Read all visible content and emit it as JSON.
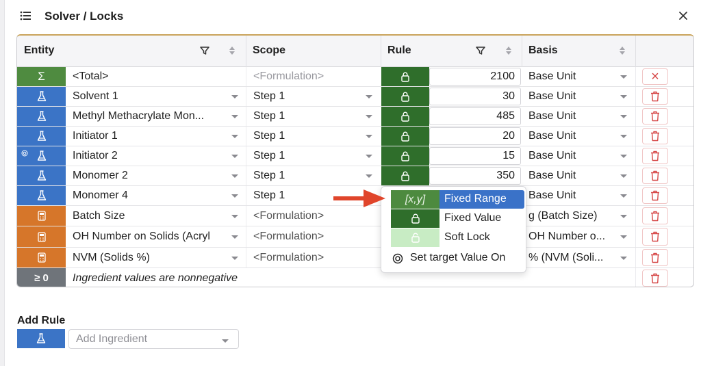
{
  "header": {
    "title": "Solver / Locks"
  },
  "table": {
    "columns": {
      "entity": "Entity",
      "scope": "Scope",
      "rule": "Rule",
      "basis": "Basis"
    },
    "rows": [
      {
        "badge": "Σ",
        "type": "sum",
        "name": "<Total>",
        "scope": "<Formulation>",
        "value": "2100",
        "basis": "Base Unit",
        "action": "×"
      },
      {
        "badge": "flask",
        "type": "ingredient",
        "name": "Solvent 1",
        "scope": "Step 1",
        "value": "30",
        "basis": "Base Unit"
      },
      {
        "badge": "flask",
        "type": "ingredient",
        "name": "Methyl Methacrylate Mon...",
        "scope": "Step 1",
        "value": "485",
        "basis": "Base Unit"
      },
      {
        "badge": "flask",
        "type": "ingredient",
        "name": "Initiator 1",
        "scope": "Step 1",
        "value": "20",
        "basis": "Base Unit"
      },
      {
        "badge": "flask",
        "type": "ingredient",
        "name": "Initiator 2",
        "scope": "Step 1",
        "value": "15",
        "basis": "Base Unit",
        "target": true
      },
      {
        "badge": "flask",
        "type": "ingredient",
        "name": "Monomer 2",
        "scope": "Step 1",
        "value": "350",
        "basis": "Base Unit"
      },
      {
        "badge": "flask",
        "type": "ingredient",
        "name": "Monomer 4",
        "scope": "Step 1",
        "value": "",
        "basis": "Base Unit"
      },
      {
        "badge": "calc",
        "type": "property",
        "name": "Batch Size",
        "scope": "<Formulation>",
        "value": "",
        "basis": "g (Batch Size)"
      },
      {
        "badge": "calc",
        "type": "property",
        "name": "OH Number on Solids (Acryl",
        "scope": "<Formulation>",
        "value": "",
        "basis": "OH Number o..."
      },
      {
        "badge": "calc",
        "type": "property",
        "name": "NVM (Solids %)",
        "scope": "<Formulation>",
        "value": "",
        "basis": "% (NVM (Soli..."
      },
      {
        "badge": "≥ 0",
        "type": "constraint",
        "name": "Ingredient values are nonnegative"
      }
    ]
  },
  "rule_menu": {
    "items": [
      {
        "swatch": "[x,y]",
        "label": "Fixed Range",
        "active": true
      },
      {
        "swatch": "lock",
        "label": "Fixed Value"
      },
      {
        "swatch": "lock-open",
        "label": "Soft Lock"
      },
      {
        "swatch": "target",
        "label": "Set target Value On"
      }
    ]
  },
  "add_rule": {
    "title": "Add Rule",
    "placeholder": "Add Ingredient"
  },
  "colors": {
    "ingredient": "#3b74c6",
    "sum": "#4f8b40",
    "property": "#d6762a",
    "constraint": "#6f747a",
    "lock": "#2f6e2b",
    "active": "#3a72c8",
    "arrow": "#e0452b",
    "delete": "#d64545"
  }
}
